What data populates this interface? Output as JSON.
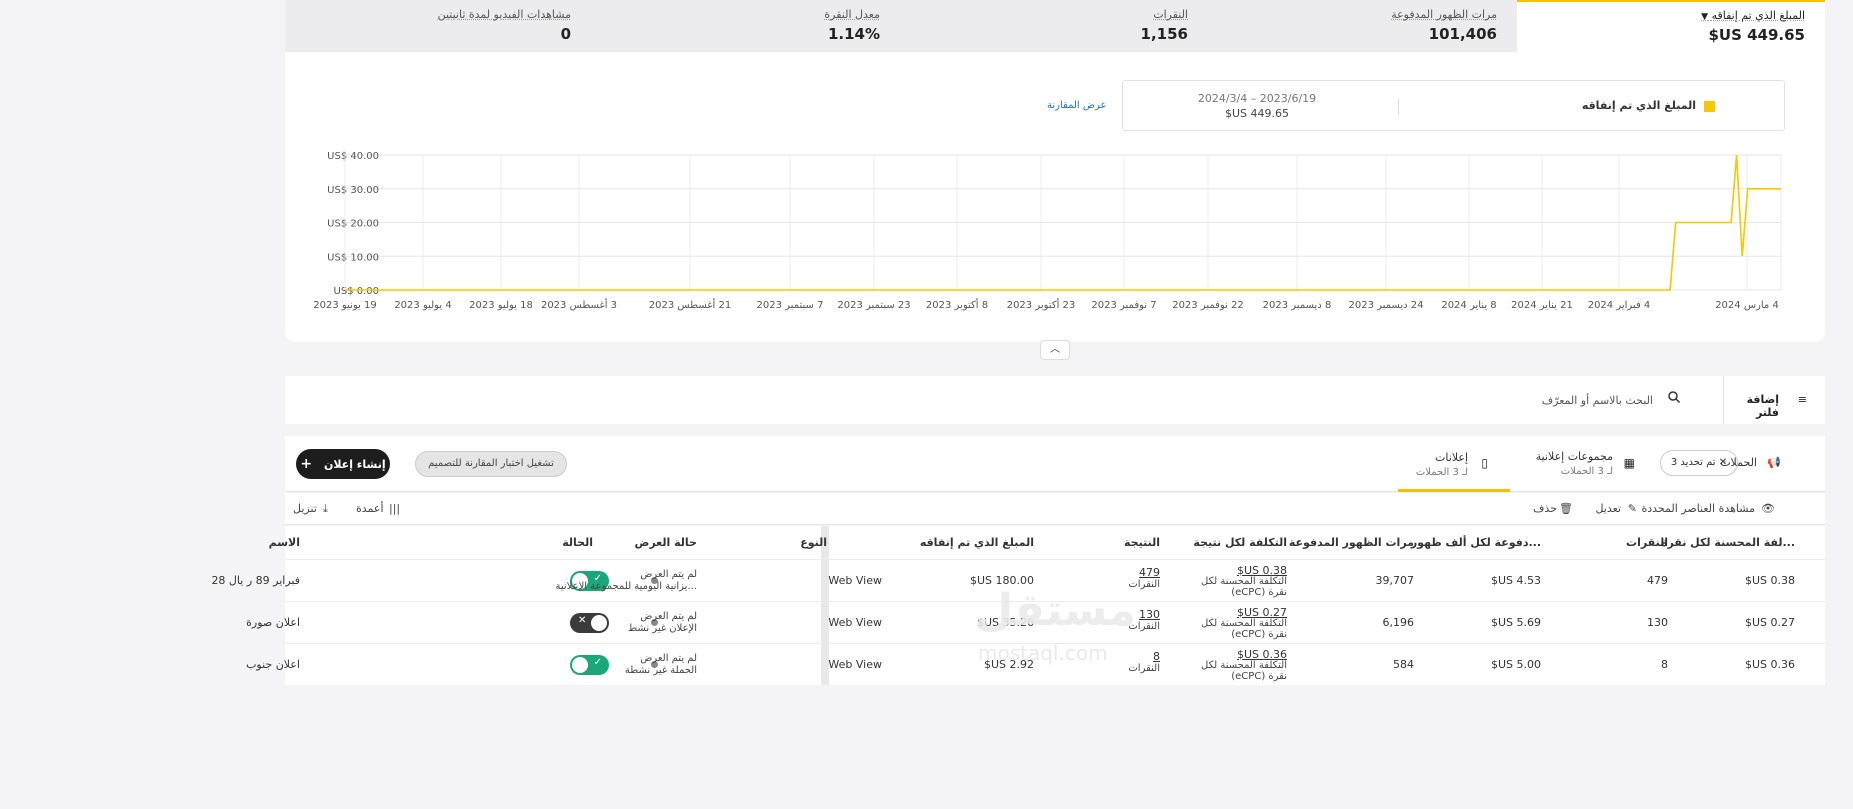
{
  "metrics": [
    {
      "label": "المبلغ الذي تم إنفاقه",
      "value": "449.65 US$",
      "selected": true
    },
    {
      "label": "مرات الظهور المدفوعة",
      "value": "101,406"
    },
    {
      "label": "النقرات",
      "value": "1,156"
    },
    {
      "label": "معدل النقرة",
      "value": "1.14%"
    },
    {
      "label": "مشاهدات الفيديو لمدة ثانيتين",
      "value": "0"
    }
  ],
  "legend": {
    "series_label": "المبلغ الذي تم إنفاقه",
    "date_range": "2023/6/19 – 2024/3/4",
    "total": "449.65 US$",
    "compare_link": "عرض المقارنة",
    "color": "#f5c800"
  },
  "chart_data": {
    "type": "line",
    "title": "",
    "xlabel": "",
    "ylabel": "",
    "y_ticks": [
      "US$ 0.00",
      "US$ 10.00",
      "US$ 20.00",
      "US$ 30.00",
      "US$ 40.00"
    ],
    "ylim": [
      0,
      40
    ],
    "x_ticks": [
      "19 يونيو 2023",
      "4 يوليو 2023",
      "18 يوليو 2023",
      "3 أغسطس 2023",
      "21 أغسطس 2023",
      "7 سبتمبر 2023",
      "23 سبتمبر 2023",
      "8 أكتوبر 2023",
      "23 أكتوبر 2023",
      "7 نوفمبر 2023",
      "22 نوفمبر 2023",
      "8 ديسمبر 2023",
      "24 ديسمبر 2023",
      "8 يناير 2024",
      "21 يناير 2024",
      "4 فبراير 2024",
      "4 مارس 2024"
    ],
    "x_range": [
      "2023-06-19",
      "2024-03-04"
    ],
    "series": [
      {
        "color": "#f5c800",
        "points": [
          {
            "x": "2023-06-19",
            "y": 0
          },
          {
            "x": "2024-02-13",
            "y": 0
          },
          {
            "x": "2024-02-14",
            "y": 20
          },
          {
            "x": "2024-02-24",
            "y": 20
          },
          {
            "x": "2024-02-25",
            "y": 40
          },
          {
            "x": "2024-02-26",
            "y": 10
          },
          {
            "x": "2024-02-27",
            "y": 30
          },
          {
            "x": "2024-03-04",
            "y": 30
          }
        ]
      }
    ],
    "grid": true
  },
  "search": {
    "add_filter": "إضافة فلتر",
    "placeholder": "البحث بالاسم أو المعرّف"
  },
  "tabs": {
    "campaigns": "الحملات",
    "selected_chip": "تم تحديد 3",
    "ad_groups_title": "مجموعات إعلانية",
    "ad_groups_sub": "لـ 3 الحملات",
    "ads_title": "إعلانات",
    "ads_sub": "لـ 3 الحملات",
    "ab_test": "تشغيل اختبار المقارنة للتصميم",
    "create_ad": "إنشاء إعلان"
  },
  "toolbar": {
    "view_selected": "مشاهدة العناصر المحددة",
    "edit": "تعديل",
    "delete": "حذف",
    "columns": "أعمدة",
    "download": "تنزيل"
  },
  "table": {
    "headers": {
      "name": "الاسم",
      "status": "الحالة",
      "delivery": "حالة العرض",
      "type": "النوع",
      "spent": "المبلغ الذي تم إنفاقه",
      "result": "النتيجة",
      "cost_per_result": "التكلفة لكل نتيجة",
      "impressions": "مرات الظهور المدفوعة",
      "cpm": "...دفوعة لكل ألف ظهور",
      "clicks": "النقرات",
      "ecpc": "...لفة المحسنة لكل نقرة"
    },
    "rows": [
      {
        "name": "فبراير 89 ر يال 28",
        "status_on": true,
        "delivery_line1": "لم يتم العرض",
        "delivery_line2": "...يزانية اليومية للمجموعة الإعلانية",
        "type": "Web View",
        "spent": "180.00 US$",
        "result_value": "479",
        "result_label": "النقرات",
        "cpr_value": "0.38 US$",
        "cpr_label1": "التكلفة المحسنة لكل",
        "cpr_label2": "نقرة (eCPC)",
        "impressions": "39,707",
        "cpm": "4.53 US$",
        "clicks": "479",
        "ecpc": "0.38 US$"
      },
      {
        "name": "اعلان صورة",
        "status_on": false,
        "delivery_line1": "لم يتم العرض",
        "delivery_line2": "الإعلان غير نشط",
        "type": "Web View",
        "spent": "35.26 US$",
        "result_value": "130",
        "result_label": "النقرات",
        "cpr_value": "0.27 US$",
        "cpr_label1": "التكلفة المحسنة لكل",
        "cpr_label2": "نقرة (eCPC)",
        "impressions": "6,196",
        "cpm": "5.69 US$",
        "clicks": "130",
        "ecpc": "0.27 US$"
      },
      {
        "name": "اعلان جنوب",
        "status_on": true,
        "delivery_line1": "لم يتم العرض",
        "delivery_line2": "الحملة غير نشطة",
        "type": "Web View",
        "spent": "2.92 US$",
        "result_value": "8",
        "result_label": "النقرات",
        "cpr_value": "0.36 US$",
        "cpr_label1": "التكلفة المحسنة لكل",
        "cpr_label2": "نقرة (eCPC)",
        "impressions": "584",
        "cpm": "5.00 US$",
        "clicks": "8",
        "ecpc": "0.36 US$"
      }
    ]
  },
  "watermark": {
    "arabic": "مستقل",
    "latin": "mostaql.com"
  }
}
